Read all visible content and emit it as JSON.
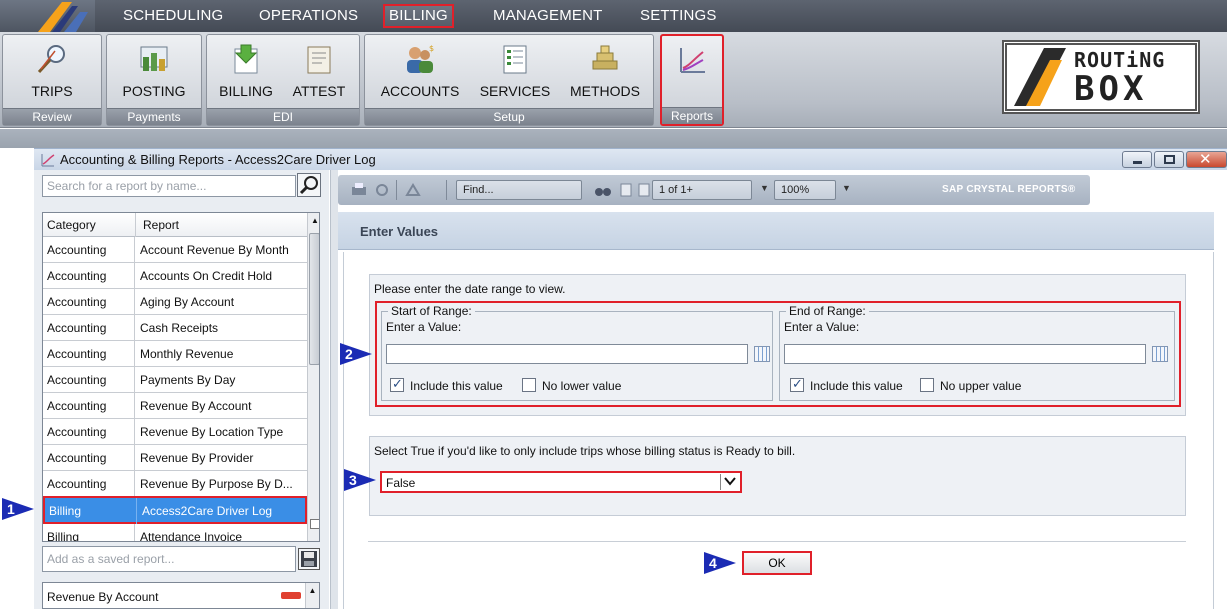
{
  "menu": {
    "items": [
      "SCHEDULING",
      "OPERATIONS",
      "BILLING",
      "MANAGEMENT",
      "SETTINGS"
    ],
    "active": "BILLING"
  },
  "ribbon": {
    "groups": [
      {
        "label": "Review",
        "buttons": [
          "TRIPS"
        ]
      },
      {
        "label": "Payments",
        "buttons": [
          "POSTING"
        ]
      },
      {
        "label": "EDI",
        "buttons": [
          "BILLING",
          "ATTEST"
        ]
      },
      {
        "label": "Setup",
        "buttons": [
          "ACCOUNTS",
          "SERVICES",
          "METHODS"
        ]
      },
      {
        "label": "Reports",
        "buttons": [
          ""
        ]
      }
    ],
    "brand": {
      "line1": "ROUTiNG",
      "line2": "BOX"
    }
  },
  "window": {
    "title": "Accounting & Billing Reports - Access2Care Driver Log"
  },
  "left": {
    "search_placeholder": "Search for a report by name...",
    "columns": [
      "Category",
      "Report"
    ],
    "rows": [
      {
        "category": "Accounting",
        "report": "Account Revenue By Month"
      },
      {
        "category": "Accounting",
        "report": "Accounts On Credit Hold"
      },
      {
        "category": "Accounting",
        "report": "Aging By Account"
      },
      {
        "category": "Accounting",
        "report": "Cash Receipts"
      },
      {
        "category": "Accounting",
        "report": "Monthly Revenue"
      },
      {
        "category": "Accounting",
        "report": "Payments By Day"
      },
      {
        "category": "Accounting",
        "report": "Revenue By Account"
      },
      {
        "category": "Accounting",
        "report": "Revenue By Location Type"
      },
      {
        "category": "Accounting",
        "report": "Revenue By Provider"
      },
      {
        "category": "Accounting",
        "report": "Revenue By Purpose By D..."
      },
      {
        "category": "Billing",
        "report": "Access2Care Driver Log"
      },
      {
        "category": "Billing",
        "report": "Attendance Invoice"
      }
    ],
    "selected_index": 10,
    "saved_placeholder": "Add as a saved report...",
    "saved_items": [
      "Revenue By Account"
    ]
  },
  "toolbar": {
    "find_placeholder": "Find...",
    "page": "1 of 1+",
    "zoom": "100%",
    "brand": "SAP CRYSTAL REPORTS®"
  },
  "params": {
    "header": "Enter Values",
    "date_prompt": "Please enter the date range to view.",
    "start": {
      "legend": "Start of Range:",
      "label": "Enter a Value:",
      "include": "Include this value",
      "no_bound": "No lower value"
    },
    "end": {
      "legend": "End of Range:",
      "label": "Enter a Value:",
      "include": "Include this value",
      "no_bound": "No upper value"
    },
    "ready_prompt": "Select True if you'd like to only include trips whose billing status is Ready to bill.",
    "ready_value": "False",
    "ok": "OK"
  },
  "steps": [
    "1",
    "2",
    "3",
    "4"
  ],
  "colors": {
    "highlight": "#e0202a",
    "selected_row": "#3a8ee6",
    "step_marker": "#1b2bb4"
  }
}
